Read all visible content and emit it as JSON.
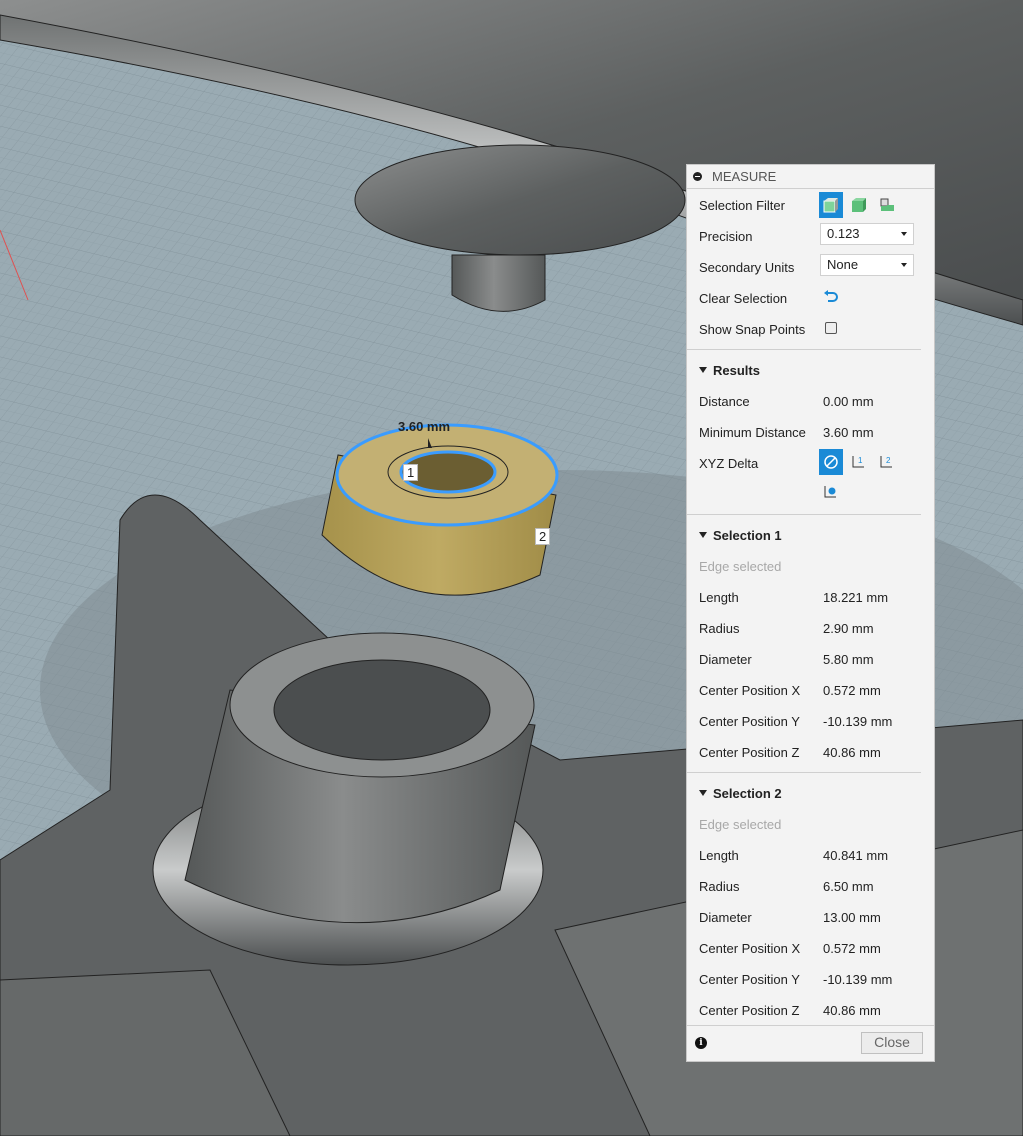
{
  "viewport": {
    "measurement_label": "3.60 mm",
    "edge_marker_1": "1",
    "edge_marker_2": "2"
  },
  "panel": {
    "title": "MEASURE",
    "selection_filter_label": "Selection Filter",
    "selection_filter_icons": [
      "select-body-icon",
      "select-face-icon",
      "select-edge-vertex-icon"
    ],
    "precision_label": "Precision",
    "precision_value": "0.123",
    "secondary_units_label": "Secondary Units",
    "secondary_units_value": "None",
    "clear_selection_label": "Clear Selection",
    "show_snap_points_label": "Show Snap Points",
    "show_snap_points_checked": false,
    "accent_color": "#1a8ad6"
  },
  "results": {
    "heading": "Results",
    "distance_label": "Distance",
    "distance_value": "0.00 mm",
    "min_distance_label": "Minimum Distance",
    "min_distance_value": "3.60 mm",
    "xyz_delta_label": "XYZ Delta",
    "xyz_icons": [
      "none-icon",
      "axis-1-icon",
      "axis-2-icon",
      "axis-world-icon"
    ]
  },
  "selection1": {
    "heading": "Selection 1",
    "type": "Edge selected",
    "rows": [
      {
        "label": "Length",
        "value": "18.221 mm"
      },
      {
        "label": "Radius",
        "value": "2.90 mm"
      },
      {
        "label": "Diameter",
        "value": "5.80 mm"
      },
      {
        "label": "Center Position X",
        "value": "0.572 mm"
      },
      {
        "label": "Center Position Y",
        "value": "-10.139 mm"
      },
      {
        "label": "Center Position Z",
        "value": "40.86 mm"
      }
    ]
  },
  "selection2": {
    "heading": "Selection 2",
    "type": "Edge selected",
    "rows": [
      {
        "label": "Length",
        "value": "40.841 mm"
      },
      {
        "label": "Radius",
        "value": "6.50 mm"
      },
      {
        "label": "Diameter",
        "value": "13.00 mm"
      },
      {
        "label": "Center Position X",
        "value": "0.572 mm"
      },
      {
        "label": "Center Position Y",
        "value": "-10.139 mm"
      },
      {
        "label": "Center Position Z",
        "value": "40.86 mm"
      }
    ]
  },
  "footer": {
    "close_label": "Close"
  }
}
